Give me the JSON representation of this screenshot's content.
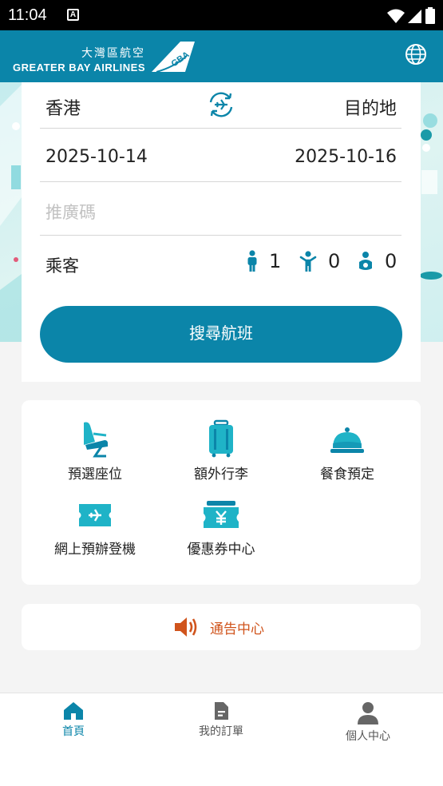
{
  "status_bar": {
    "time": "11:04",
    "notification_icon": "A"
  },
  "header": {
    "logo_zh": "大灣區航空",
    "logo_en": "GREATER BAY AIRLINES",
    "logo_mark": "GBA",
    "language_icon": "globe-icon"
  },
  "search": {
    "origin": "香港",
    "destination": "目的地",
    "depart_date": "2025-10-14",
    "return_date": "2025-10-16",
    "promo_placeholder": "推廣碼",
    "passengers_label": "乘客",
    "adults": "1",
    "children": "0",
    "infants": "0",
    "search_button": "搜尋航班"
  },
  "services": [
    {
      "label": "預選座位",
      "icon": "seat-icon"
    },
    {
      "label": "額外行李",
      "icon": "luggage-icon"
    },
    {
      "label": "餐食預定",
      "icon": "meal-cloche-icon"
    },
    {
      "label": "網上預辦登機",
      "icon": "boarding-ticket-icon"
    },
    {
      "label": "優惠券中心",
      "icon": "coupon-icon"
    }
  ],
  "notice": {
    "label": "通告中心",
    "icon": "speaker-icon"
  },
  "bottom_nav": [
    {
      "label": "首頁",
      "icon": "home-icon",
      "active": true
    },
    {
      "label": "我的訂單",
      "icon": "document-icon",
      "active": false
    },
    {
      "label": "個人中心",
      "icon": "user-icon",
      "active": false
    }
  ],
  "colors": {
    "brand": "#0b85a9",
    "notice": "#d0541c",
    "service_teal": "#1fb3c7"
  }
}
